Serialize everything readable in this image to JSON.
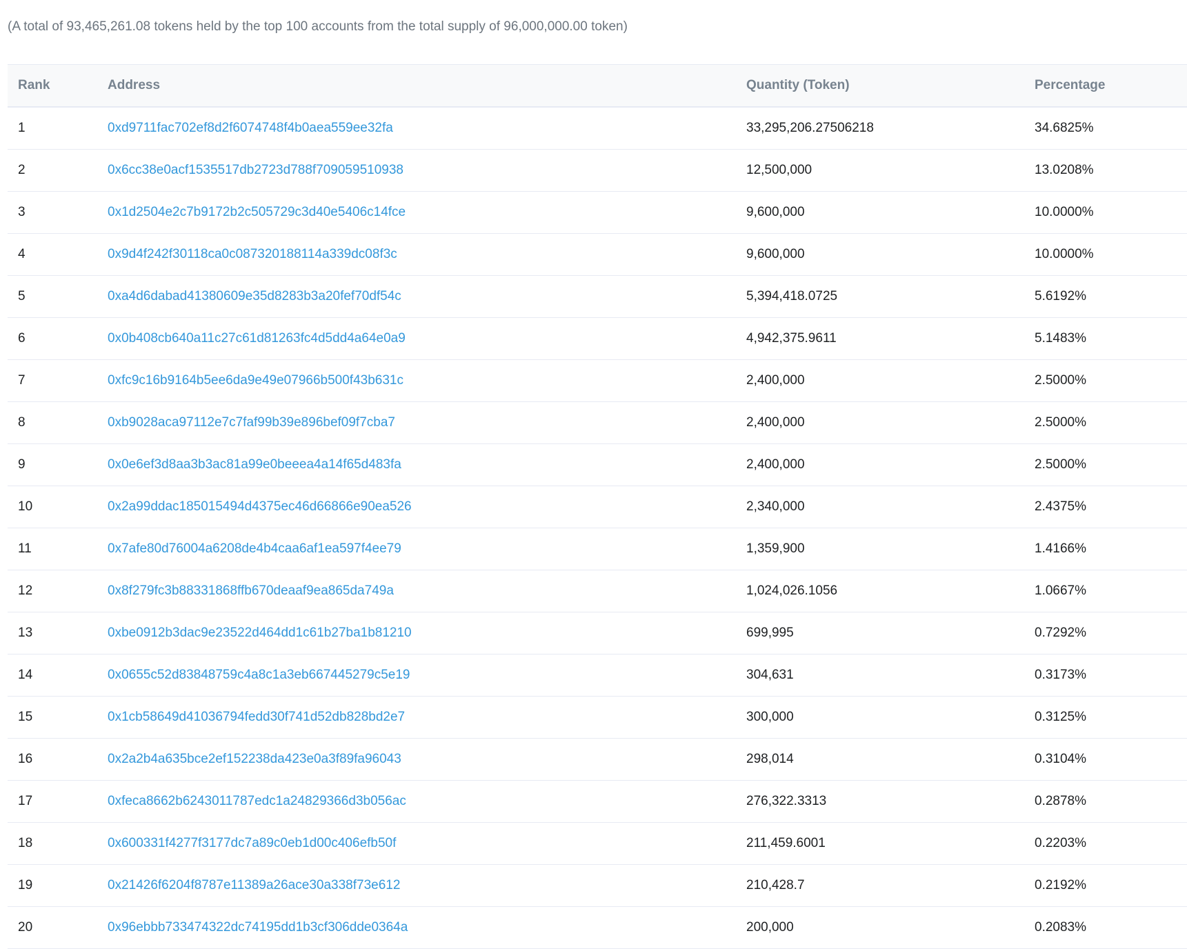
{
  "summary": "(A total of 93,465,261.08 tokens held by the top 100 accounts from the total supply of 96,000,000.00 token)",
  "table": {
    "headers": [
      "Rank",
      "Address",
      "Quantity (Token)",
      "Percentage"
    ],
    "rows": [
      {
        "rank": "1",
        "address": "0xd9711fac702ef8d2f6074748f4b0aea559ee32fa",
        "quantity": "33,295,206.27506218",
        "percentage": "34.6825%"
      },
      {
        "rank": "2",
        "address": "0x6cc38e0acf1535517db2723d788f709059510938",
        "quantity": "12,500,000",
        "percentage": "13.0208%"
      },
      {
        "rank": "3",
        "address": "0x1d2504e2c7b9172b2c505729c3d40e5406c14fce",
        "quantity": "9,600,000",
        "percentage": "10.0000%"
      },
      {
        "rank": "4",
        "address": "0x9d4f242f30118ca0c087320188114a339dc08f3c",
        "quantity": "9,600,000",
        "percentage": "10.0000%"
      },
      {
        "rank": "5",
        "address": "0xa4d6dabad41380609e35d8283b3a20fef70df54c",
        "quantity": "5,394,418.0725",
        "percentage": "5.6192%"
      },
      {
        "rank": "6",
        "address": "0x0b408cb640a11c27c61d81263fc4d5dd4a64e0a9",
        "quantity": "4,942,375.9611",
        "percentage": "5.1483%"
      },
      {
        "rank": "7",
        "address": "0xfc9c16b9164b5ee6da9e49e07966b500f43b631c",
        "quantity": "2,400,000",
        "percentage": "2.5000%"
      },
      {
        "rank": "8",
        "address": "0xb9028aca97112e7c7faf99b39e896bef09f7cba7",
        "quantity": "2,400,000",
        "percentage": "2.5000%"
      },
      {
        "rank": "9",
        "address": "0x0e6ef3d8aa3b3ac81a99e0beeea4a14f65d483fa",
        "quantity": "2,400,000",
        "percentage": "2.5000%"
      },
      {
        "rank": "10",
        "address": "0x2a99ddac185015494d4375ec46d66866e90ea526",
        "quantity": "2,340,000",
        "percentage": "2.4375%"
      },
      {
        "rank": "11",
        "address": "0x7afe80d76004a6208de4b4caa6af1ea597f4ee79",
        "quantity": "1,359,900",
        "percentage": "1.4166%"
      },
      {
        "rank": "12",
        "address": "0x8f279fc3b88331868ffb670deaaf9ea865da749a",
        "quantity": "1,024,026.1056",
        "percentage": "1.0667%"
      },
      {
        "rank": "13",
        "address": "0xbe0912b3dac9e23522d464dd1c61b27ba1b81210",
        "quantity": "699,995",
        "percentage": "0.7292%"
      },
      {
        "rank": "14",
        "address": "0x0655c52d83848759c4a8c1a3eb667445279c5e19",
        "quantity": "304,631",
        "percentage": "0.3173%"
      },
      {
        "rank": "15",
        "address": "0x1cb58649d41036794fedd30f741d52db828bd2e7",
        "quantity": "300,000",
        "percentage": "0.3125%"
      },
      {
        "rank": "16",
        "address": "0x2a2b4a635bce2ef152238da423e0a3f89fa96043",
        "quantity": "298,014",
        "percentage": "0.3104%"
      },
      {
        "rank": "17",
        "address": "0xfeca8662b6243011787edc1a24829366d3b056ac",
        "quantity": "276,322.3313",
        "percentage": "0.2878%"
      },
      {
        "rank": "18",
        "address": "0x600331f4277f3177dc7a89c0eb1d00c406efb50f",
        "quantity": "211,459.6001",
        "percentage": "0.2203%"
      },
      {
        "rank": "19",
        "address": "0x21426f6204f8787e11389a26ace30a338f73e612",
        "quantity": "210,428.7",
        "percentage": "0.2192%"
      },
      {
        "rank": "20",
        "address": "0x96ebbb733474322dc74195dd1b3cf306dde0364a",
        "quantity": "200,000",
        "percentage": "0.2083%"
      }
    ]
  },
  "colors": {
    "link": "#3498db",
    "header_text": "#77838f",
    "body_text": "#1e2022",
    "muted_text": "#6c757e",
    "border": "#e7eaf3",
    "header_bg": "#f8f9fa"
  }
}
